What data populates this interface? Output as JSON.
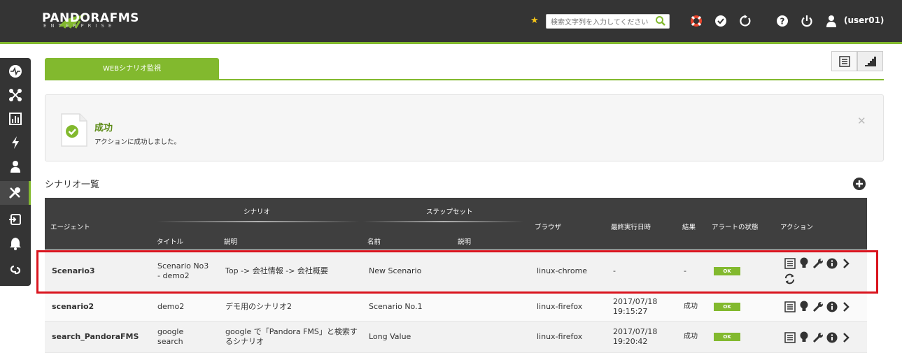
{
  "brand": {
    "name": "PANDORAFMS",
    "subtitle": "ENTERPRISE",
    "accent": "#82b92e",
    "header_bg": "#343434"
  },
  "header": {
    "search_placeholder": "検索文字列を入力してください",
    "user": "(user01)"
  },
  "tab": {
    "label": "WEBシナリオ監視"
  },
  "alert": {
    "title": "成功",
    "message": "アクションに成功しました。"
  },
  "section": {
    "title": "シナリオ一覧"
  },
  "table": {
    "headers": {
      "agent": "エージェント",
      "scenario_group": "シナリオ",
      "stepset_group": "ステップセット",
      "title": "タイトル",
      "description": "説明",
      "name": "名前",
      "step_description": "説明",
      "browser": "ブラウザ",
      "last_run": "最終実行日時",
      "result": "結果",
      "alert_status": "アラートの状態",
      "actions": "アクション"
    },
    "rows": [
      {
        "agent": "Scenario3",
        "title_line1": "Scenario No3",
        "title_line2": "- demo2",
        "description_line1": "Top -> 会社情報 -> 会社概要",
        "description_line2": "",
        "stepset": "New Scenario",
        "browser": "linux-chrome",
        "last_run_line1": "-",
        "last_run_line2": "",
        "result": "-",
        "alert": "OK"
      },
      {
        "agent": "scenario2",
        "title_line1": "demo2",
        "title_line2": "",
        "description_line1": "デモ用のシナリオ2",
        "description_line2": "",
        "stepset": "Scenario No.1",
        "browser": "linux-firefox",
        "last_run_line1": "2017/07/18",
        "last_run_line2": "19:15:27",
        "result": "成功",
        "alert": "OK"
      },
      {
        "agent": "search_PandoraFMS",
        "title_line1": "google",
        "title_line2": "search",
        "description_line1": "google で「Pandora FMS」と検索す",
        "description_line2": "るシナリオ",
        "stepset": "Long Value",
        "browser": "linux-firefox",
        "last_run_line1": "2017/07/18",
        "last_run_line2": "19:20:42",
        "result": "成功",
        "alert": "OK"
      }
    ]
  },
  "icons": {
    "sidebar": [
      "monitoring-icon",
      "topology-icon",
      "reporting-icon",
      "events-icon",
      "users-icon",
      "tools-icon",
      "servers-icon",
      "alerts-icon",
      "links-icon"
    ],
    "header": [
      "favorite-star-icon",
      "search-icon",
      "help-lifebuoy-icon",
      "check-icon",
      "refresh-icon",
      "question-icon",
      "power-icon",
      "user-icon"
    ],
    "row_actions": [
      "detail-list-icon",
      "bulb-icon",
      "wrench-icon",
      "info-icon",
      "chevron-right-icon",
      "reload-icon"
    ]
  }
}
